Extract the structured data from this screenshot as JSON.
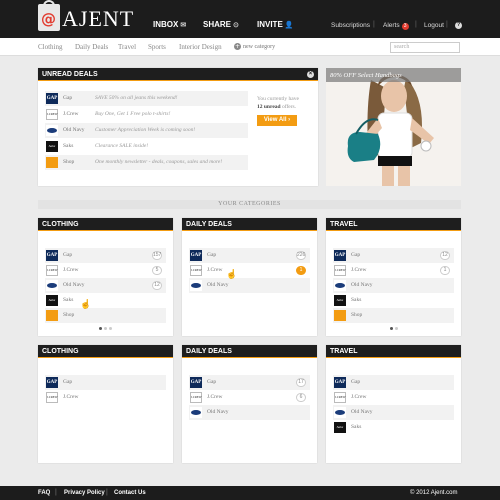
{
  "brand": {
    "name": "AJENT",
    "at": "@"
  },
  "nav": {
    "inbox": "INBOX",
    "share": "SHARE",
    "invite": "INVITE"
  },
  "toplinks": {
    "subscriptions": "Subscriptions",
    "alerts": "Alerts",
    "alerts_count": "3",
    "logout": "Logout",
    "help": "?"
  },
  "categories": [
    "Clothing",
    "Daily Deals",
    "Travel",
    "Sports",
    "Interior Design"
  ],
  "new_category": "new category",
  "search": {
    "placeholder": "search"
  },
  "unread": {
    "title": "UNREAD DEALS",
    "rows": [
      {
        "store": "Gap",
        "logo": "gap",
        "message": "SAVE 50% on all jeans this weekend!"
      },
      {
        "store": "J.Crew",
        "logo": "jcrew",
        "message": "Buy One, Get 1 Free polo t-shirts!"
      },
      {
        "store": "Old Navy",
        "logo": "oldnavy",
        "message": "Customer Appreciation Week is coming soon!"
      },
      {
        "store": "Saks",
        "logo": "saks",
        "message": "Clearance SALE inside!"
      },
      {
        "store": "Shop",
        "logo": "shop",
        "message": "One monthly newsletter - deals, coupons, sales and more!"
      }
    ],
    "side_text_1": "You currently have",
    "side_text_bold": "12 unread",
    "side_text_2": "offers.",
    "view_all": "View All ›"
  },
  "ad": {
    "label": "80% OFF Select Handbags"
  },
  "your_categories": "YOUR CATEGORIES",
  "panels_row1": [
    {
      "title": "CLOTHING",
      "rows": [
        {
          "store": "Gap",
          "logo": "gap",
          "count": "157"
        },
        {
          "store": "J.Crew",
          "logo": "jcrew",
          "count": "5"
        },
        {
          "store": "Old Navy",
          "logo": "oldnavy",
          "count": "12"
        },
        {
          "store": "Saks",
          "logo": "saks",
          "count": ""
        },
        {
          "store": "Shop",
          "logo": "shop",
          "count": ""
        }
      ]
    },
    {
      "title": "DAILY DEALS",
      "rows": [
        {
          "store": "Gap",
          "logo": "gap",
          "count": "226"
        },
        {
          "store": "J.Crew",
          "logo": "jcrew",
          "count": "1"
        },
        {
          "store": "Old Navy",
          "logo": "oldnavy",
          "count": ""
        }
      ]
    },
    {
      "title": "TRAVEL",
      "rows": [
        {
          "store": "Gap",
          "logo": "gap",
          "count": "12"
        },
        {
          "store": "J.Crew",
          "logo": "jcrew",
          "count": "1"
        },
        {
          "store": "Old Navy",
          "logo": "oldnavy",
          "count": ""
        },
        {
          "store": "Saks",
          "logo": "saks",
          "count": ""
        },
        {
          "store": "Shop",
          "logo": "shop",
          "count": ""
        }
      ]
    }
  ],
  "panels_row2": [
    {
      "title": "CLOTHING",
      "rows": [
        {
          "store": "Gap",
          "logo": "gap",
          "count": ""
        },
        {
          "store": "J.Crew",
          "logo": "jcrew",
          "count": ""
        }
      ]
    },
    {
      "title": "DAILY DEALS",
      "rows": [
        {
          "store": "Gap",
          "logo": "gap",
          "count": "17"
        },
        {
          "store": "J.Crew",
          "logo": "jcrew",
          "count": "6"
        },
        {
          "store": "Old Navy",
          "logo": "oldnavy",
          "count": ""
        }
      ]
    },
    {
      "title": "TRAVEL",
      "rows": [
        {
          "store": "Gap",
          "logo": "gap",
          "count": ""
        },
        {
          "store": "J.Crew",
          "logo": "jcrew",
          "count": ""
        },
        {
          "store": "Old Navy",
          "logo": "oldnavy",
          "count": ""
        },
        {
          "store": "Saks",
          "logo": "saks",
          "count": ""
        }
      ]
    }
  ],
  "footer": {
    "faq": "FAQ",
    "privacy": "Privacy Policy",
    "contact": "Contact Us",
    "copyright": "© 2012 Ajent.com"
  },
  "colors": {
    "accent": "#f39c12",
    "header": "#1c1c1c",
    "alert": "#e23b2f"
  }
}
